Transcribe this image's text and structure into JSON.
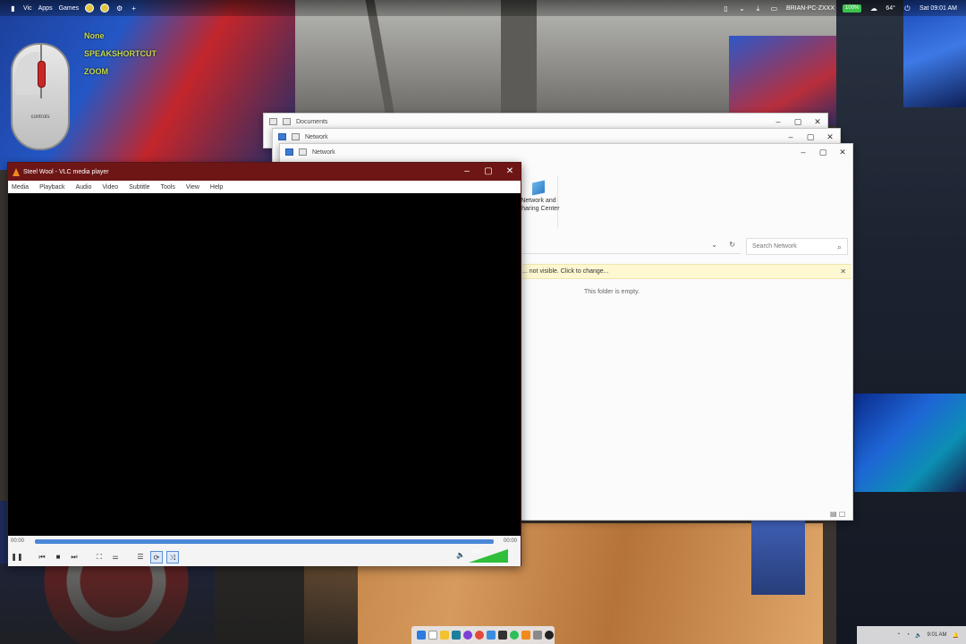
{
  "topbar": {
    "left_items": [
      "Vic",
      "Apps",
      "Games"
    ],
    "right_items": {
      "network": "BRIAN-PC-ZXXX",
      "battery": "100%",
      "temperature": "64°",
      "time": "Sat 09:01 AM"
    }
  },
  "mouse_overlay": {
    "labels": [
      "None",
      "SPEAKSHORTCUT",
      "ZOOM"
    ],
    "mouse_label": "controls"
  },
  "explorer": {
    "windows": [
      {
        "path": "Documents"
      },
      {
        "path": "Network"
      },
      {
        "path": "Network"
      }
    ],
    "ribbon_item": "Network and Sharing Center",
    "search_placeholder": "Search Network",
    "infobar_text": "... not visible. Click to change...",
    "empty_message": "This folder is empty."
  },
  "vlc": {
    "title": "Steel Wool - VLC media player",
    "menu": [
      "Media",
      "Playback",
      "Audio",
      "Video",
      "Subtitle",
      "Tools",
      "View",
      "Help"
    ],
    "time_elapsed": "00:00",
    "time_total": "00:00",
    "progress": 1.0,
    "volume_label": "100%",
    "volume": 1.0,
    "accent": "#6e1616"
  },
  "taskbar": {
    "icons": [
      "windows-start",
      "search",
      "file-explorer",
      "edge",
      "chrome",
      "store",
      "terminal",
      "spotify",
      "vlc",
      "settings",
      "camera",
      "obs"
    ],
    "tray_time": "9:01 AM"
  }
}
